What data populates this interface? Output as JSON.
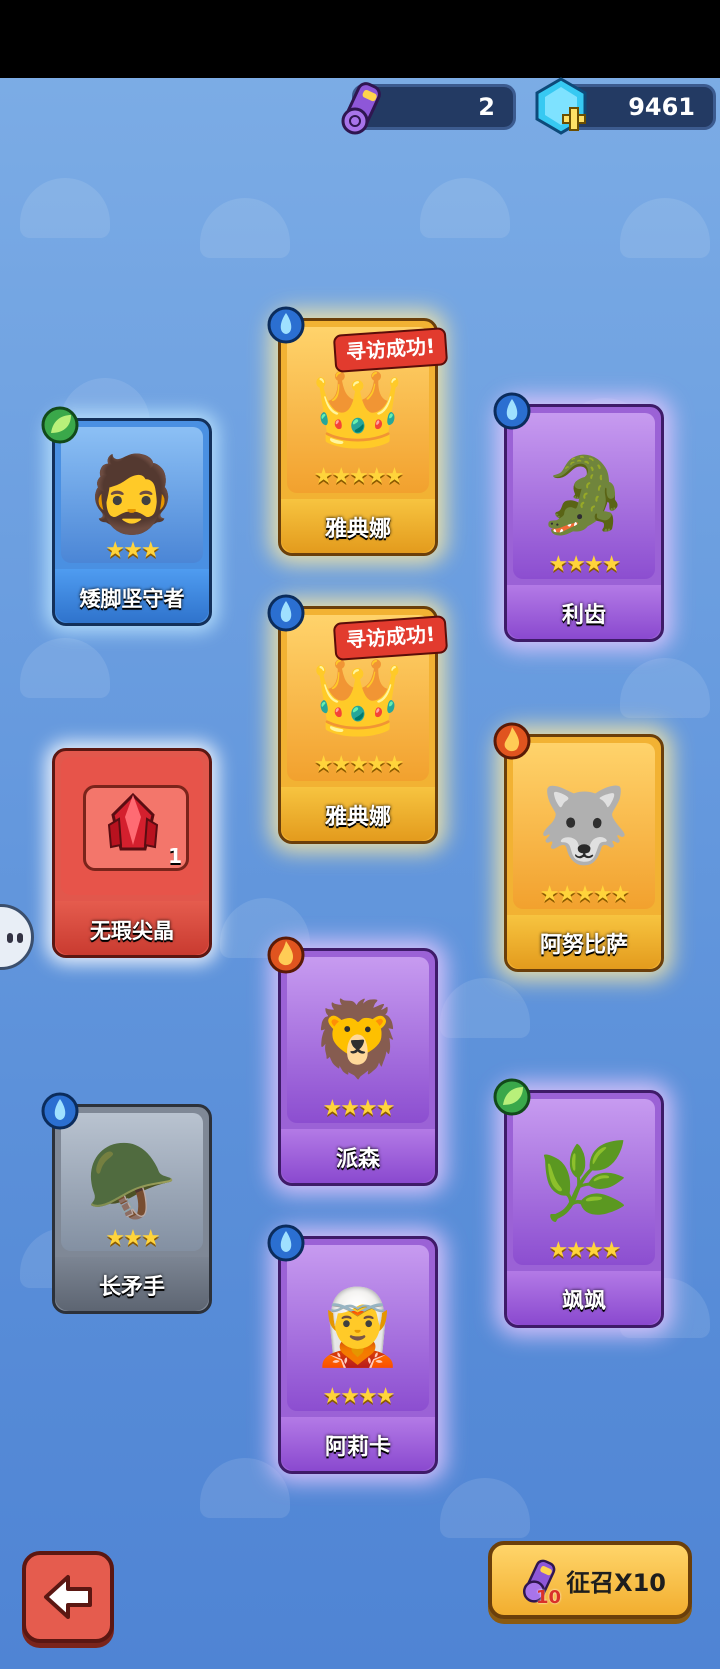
{
  "currency": {
    "scroll_count": "2",
    "gems": "9461"
  },
  "badge_text": "寻访成功!",
  "cards": {
    "athena1": {
      "name": "雅典娜",
      "stars": "★★★★★",
      "element": "water",
      "rarity": "gold"
    },
    "athena2": {
      "name": "雅典娜",
      "stars": "★★★★★",
      "element": "water",
      "rarity": "gold"
    },
    "dwarf": {
      "name": "矮脚坚守者",
      "stars": "★★★",
      "element": "leaf",
      "rarity": "blue"
    },
    "lichi": {
      "name": "利齿",
      "stars": "★★★★",
      "element": "water",
      "rarity": "purple"
    },
    "crystal": {
      "name": "无瑕尖晶",
      "count": "1",
      "rarity": "red"
    },
    "anubis": {
      "name": "阿努比萨",
      "stars": "★★★★★",
      "element": "fire",
      "rarity": "gold"
    },
    "paisen": {
      "name": "派森",
      "stars": "★★★★",
      "element": "fire",
      "rarity": "purple"
    },
    "spear": {
      "name": "长矛手",
      "stars": "★★★",
      "element": "water",
      "rarity": "grey"
    },
    "sasa": {
      "name": "飒飒",
      "stars": "★★★★",
      "element": "leaf",
      "rarity": "purple"
    },
    "alika": {
      "name": "阿莉卡",
      "stars": "★★★★",
      "element": "water",
      "rarity": "purple"
    }
  },
  "summon": {
    "label": "征召X10",
    "count": "10"
  },
  "colors": {
    "gold": "#f2b233",
    "purple": "#9b62d6",
    "blue": "#4a90e2",
    "grey": "#7f8896",
    "red": "#e2574c"
  }
}
